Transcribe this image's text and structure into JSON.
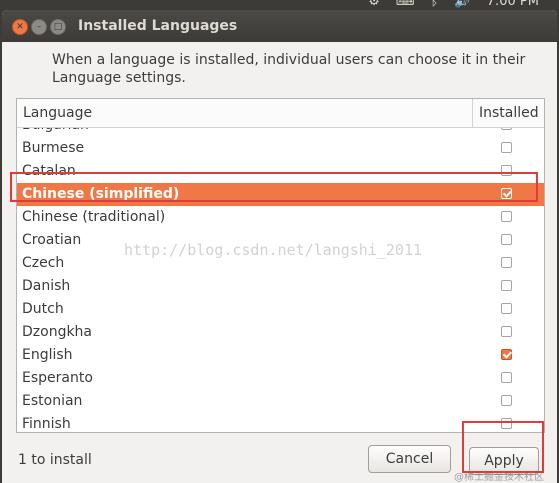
{
  "top_panel": {
    "clock": "7:00 PM"
  },
  "window": {
    "title": "Installed Languages"
  },
  "intro_text": "When a language is installed, individual users can choose it in their Language settings.",
  "table": {
    "headers": {
      "language": "Language",
      "installed": "Installed"
    },
    "rows": [
      {
        "label": "Bulgarian",
        "installed": false
      },
      {
        "label": "Burmese",
        "installed": false
      },
      {
        "label": "Catalan",
        "installed": false
      },
      {
        "label": "Chinese (simplified)",
        "installed": true,
        "selected": true
      },
      {
        "label": "Chinese (traditional)",
        "installed": false
      },
      {
        "label": "Croatian",
        "installed": false
      },
      {
        "label": "Czech",
        "installed": false
      },
      {
        "label": "Danish",
        "installed": false
      },
      {
        "label": "Dutch",
        "installed": false
      },
      {
        "label": "Dzongkha",
        "installed": false
      },
      {
        "label": "English",
        "installed": true
      },
      {
        "label": "Esperanto",
        "installed": false
      },
      {
        "label": "Estonian",
        "installed": false
      },
      {
        "label": "Finnish",
        "installed": false
      }
    ]
  },
  "status_text": "1 to install",
  "buttons": {
    "cancel": "Cancel",
    "apply": "Apply"
  },
  "watermark": "http://blog.csdn.net/langshi_2011",
  "corner_watermark": "@稀土掘金技术社区",
  "colors": {
    "accent": "#f07746",
    "titlebar": "#3c3b37",
    "highlight": "#e03c3c"
  }
}
